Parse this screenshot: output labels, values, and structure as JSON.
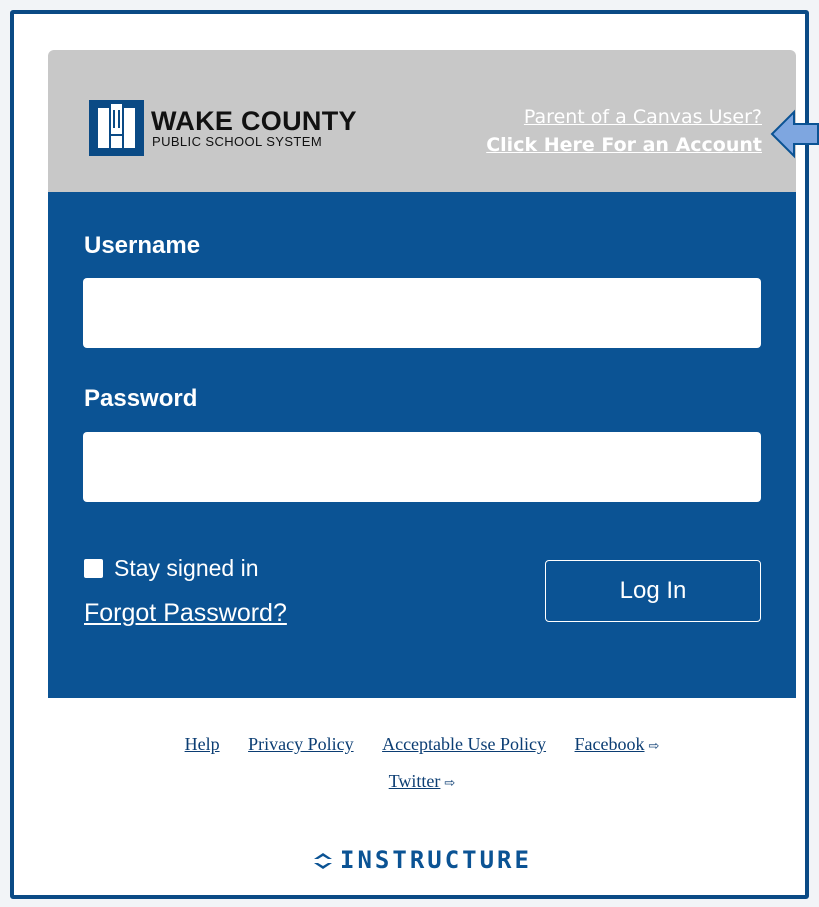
{
  "header": {
    "logo_title": "WAKE COUNTY",
    "logo_subtitle": "PUBLIC SCHOOL SYSTEM",
    "parent_link_line1": "Parent of a Canvas User?",
    "parent_link_line2": "Click Here For an Account"
  },
  "form": {
    "username_label": "Username",
    "username_value": "",
    "password_label": "Password",
    "password_value": "",
    "stay_signed_in_label": "Stay signed in",
    "stay_signed_in_checked": false,
    "forgot_password_label": "Forgot Password?",
    "login_button_label": "Log In"
  },
  "footer": {
    "links": [
      "Help",
      "Privacy Policy",
      "Acceptable Use Policy",
      "Facebook",
      "Twitter"
    ],
    "brand": "INSTRUCTURE"
  },
  "colors": {
    "primary": "#0b5394",
    "header_bg": "#c8c8c8",
    "callout_arrow": "#7ea6e0"
  },
  "icons": [
    "school-logo-icon",
    "external-link-icon",
    "instructure-logo-icon",
    "callout-arrow-icon"
  ]
}
